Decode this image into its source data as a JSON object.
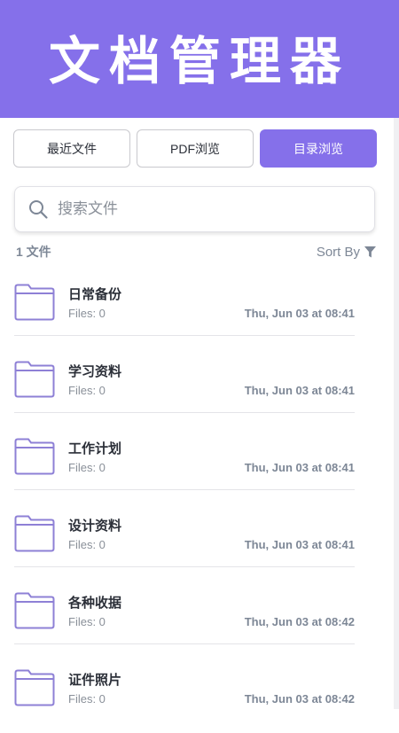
{
  "header": {
    "title": "文档管理器"
  },
  "tabs": [
    {
      "label": "最近文件",
      "active": false
    },
    {
      "label": "PDF浏览",
      "active": false
    },
    {
      "label": "目录浏览",
      "active": true
    }
  ],
  "search": {
    "placeholder": "搜索文件",
    "value": ""
  },
  "summary": {
    "file_count": "1 文件",
    "sort_label": "Sort By"
  },
  "folders": [
    {
      "name": "日常备份",
      "files": "Files: 0",
      "date": "Thu, Jun 03 at 08:41"
    },
    {
      "name": "学习资料",
      "files": "Files: 0",
      "date": "Thu, Jun 03 at 08:41"
    },
    {
      "name": "工作计划",
      "files": "Files: 0",
      "date": "Thu, Jun 03 at 08:41"
    },
    {
      "name": "设计资料",
      "files": "Files: 0",
      "date": "Thu, Jun 03 at 08:41"
    },
    {
      "name": "各种收据",
      "files": "Files: 0",
      "date": "Thu, Jun 03 at 08:42"
    },
    {
      "name": "证件照片",
      "files": "Files: 0",
      "date": "Thu, Jun 03 at 08:42"
    }
  ],
  "colors": {
    "accent": "#8570ea",
    "icon_stroke": "#8e80d6",
    "muted_text": "#7d8796"
  },
  "icons": {
    "search": "search-icon",
    "filter": "filter-icon",
    "folder": "folder-icon"
  }
}
